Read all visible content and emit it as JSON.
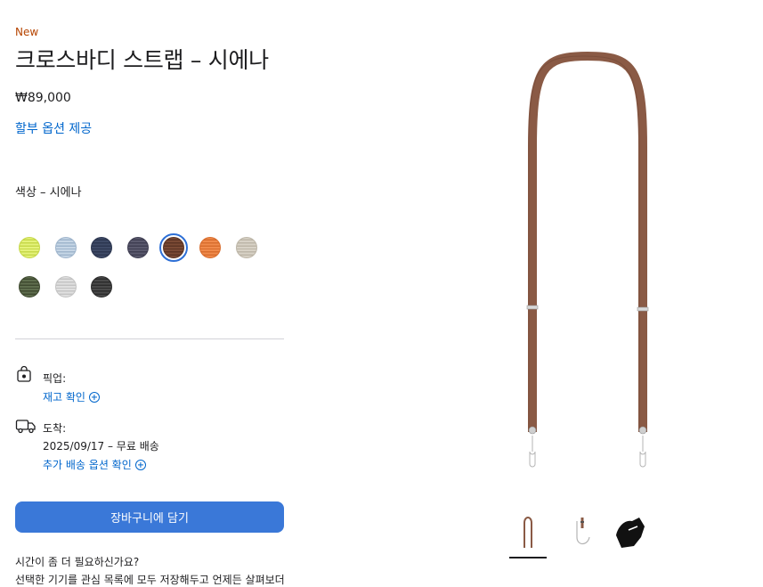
{
  "product": {
    "badge": "New",
    "title": "크로스바디 스트랩 – 시에나",
    "price": "₩89,000",
    "finance_link": "할부 옵션 제공",
    "color_label": "색상 – 시에나"
  },
  "swatches": [
    {
      "name": "라임",
      "color": "#e4f27a",
      "stripe": "#c6d84a"
    },
    {
      "name": "라이트 블루",
      "color": "#c6d6e6",
      "stripe": "#9fb5cc"
    },
    {
      "name": "네이비",
      "color": "#3e4a66",
      "stripe": "#2c3650"
    },
    {
      "name": "퍼플 그레이",
      "color": "#5b5a6e",
      "stripe": "#3f3e52"
    },
    {
      "name": "시에나",
      "color": "#7a4a35",
      "stripe": "#5c3424",
      "selected": true
    },
    {
      "name": "오렌지",
      "color": "#f08a4b",
      "stripe": "#d86d2e"
    },
    {
      "name": "스톤",
      "color": "#d8d2c6",
      "stripe": "#bdb6a8"
    },
    {
      "name": "올리브",
      "color": "#5f6e4e",
      "stripe": "#3f4a30"
    },
    {
      "name": "라이트 그레이",
      "color": "#e0e0e0",
      "stripe": "#c4c4c4"
    },
    {
      "name": "블랙",
      "color": "#4a4a4a",
      "stripe": "#2c2c2c"
    }
  ],
  "pickup": {
    "icon": "apple-bag-icon",
    "label": "픽업:",
    "link": "재고 확인"
  },
  "delivery": {
    "icon": "delivery-truck-icon",
    "label": "도착:",
    "detail": "2025/09/17 – 무료 배송",
    "link": "추가 배송 옵션 확인"
  },
  "add_to_bag": "장바구니에 담기",
  "help": {
    "line1": "시간이 좀 더 필요하신가요?",
    "line2": "선택한 기기를 관심 목록에 모두 저장해두고 언제든 살펴보더"
  },
  "colors": {
    "accent": "#06c",
    "button": "#3a78d8",
    "strap": "#8a5a45",
    "new_badge": "#b64400"
  }
}
